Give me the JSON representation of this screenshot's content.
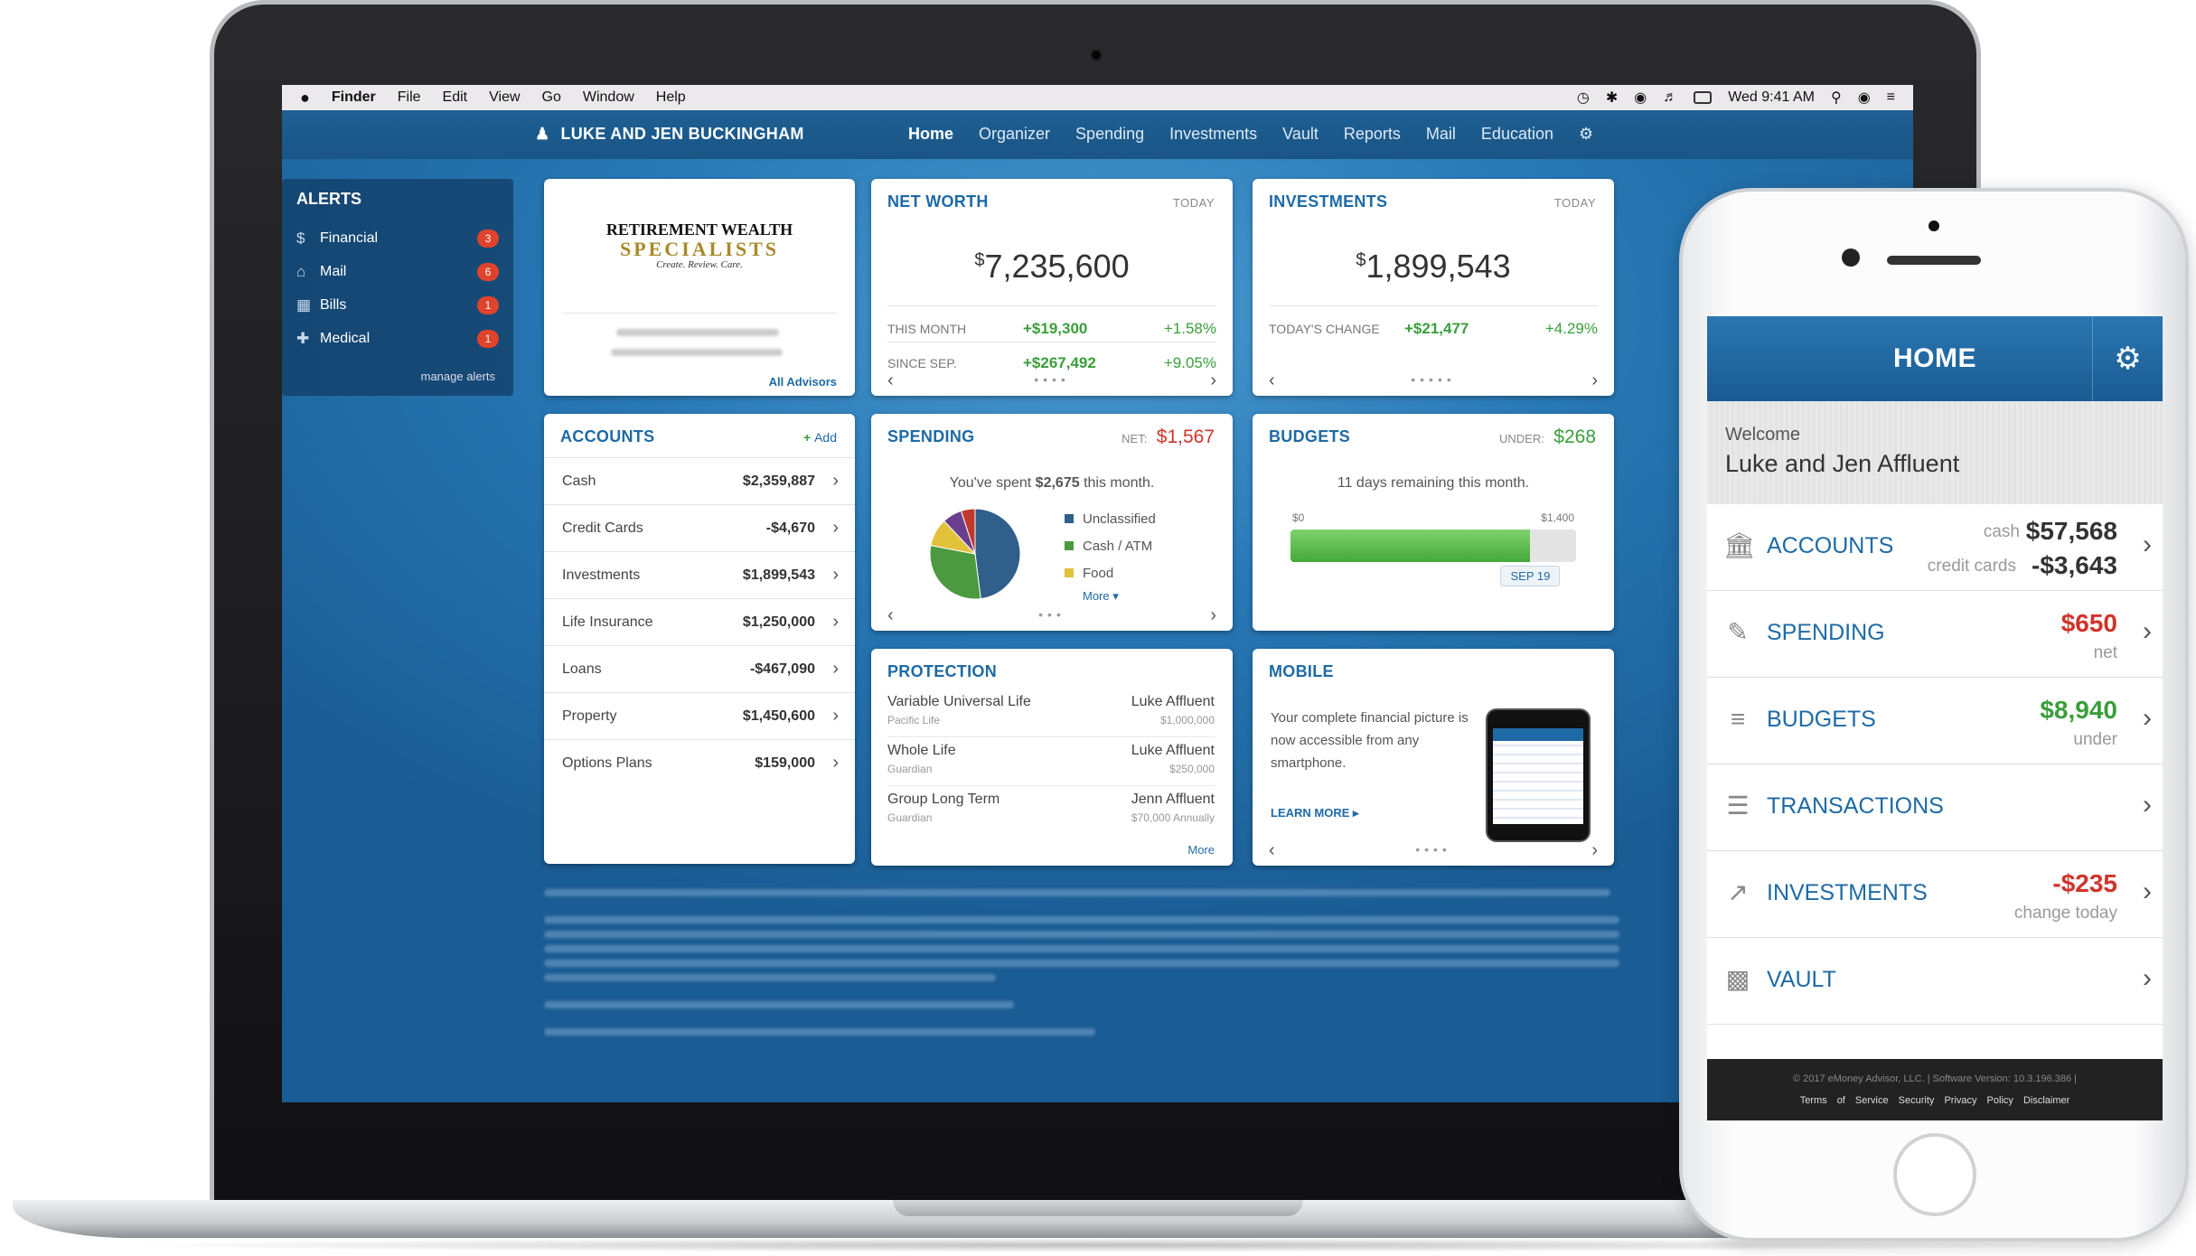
{
  "menubar": {
    "apple": "",
    "items": [
      "Finder",
      "File",
      "Edit",
      "View",
      "Go",
      "Window",
      "Help"
    ],
    "clock": "Wed 9:41 AM"
  },
  "app": {
    "user": "LUKE AND JEN BUCKINGHAM",
    "nav": [
      "Home",
      "Organizer",
      "Spending",
      "Investments",
      "Vault",
      "Reports",
      "Mail",
      "Education"
    ]
  },
  "alerts": {
    "title": "ALERTS",
    "items": [
      {
        "label": "Financial",
        "count": "3"
      },
      {
        "label": "Mail",
        "count": "6"
      },
      {
        "label": "Bills",
        "count": "1"
      },
      {
        "label": "Medical",
        "count": "1"
      }
    ],
    "manage": "manage alerts"
  },
  "advisor": {
    "logo_line1": "RETIREMENT WEALTH",
    "logo_line2": "SPECIALISTS",
    "tagline": "Create. Review. Care.",
    "all_advisors": "All Advisors"
  },
  "net_worth": {
    "title": "NET WORTH",
    "tag": "TODAY",
    "currency": "$",
    "value": "7,235,600",
    "row1": {
      "label": "THIS MONTH",
      "v1": "+$19,300",
      "v2": "+1.58%"
    },
    "row2": {
      "label": "SINCE SEP.",
      "v1": "+$267,492",
      "v2": "+9.05%"
    }
  },
  "investments": {
    "title": "INVESTMENTS",
    "tag": "TODAY",
    "currency": "$",
    "value": "1,899,543",
    "row1": {
      "label": "TODAY'S CHANGE",
      "v1": "+$21,477",
      "v2": "+4.29%"
    }
  },
  "accounts": {
    "title": "ACCOUNTS",
    "add": "Add",
    "rows": [
      {
        "label": "Cash",
        "value": "$2,359,887"
      },
      {
        "label": "Credit Cards",
        "value": "-$4,670"
      },
      {
        "label": "Investments",
        "value": "$1,899,543"
      },
      {
        "label": "Life Insurance",
        "value": "$1,250,000"
      },
      {
        "label": "Loans",
        "value": "-$467,090"
      },
      {
        "label": "Property",
        "value": "$1,450,600"
      },
      {
        "label": "Options Plans",
        "value": "$159,000"
      }
    ]
  },
  "spending": {
    "title": "SPENDING",
    "net_label": "NET:",
    "net_value": "$1,567",
    "summary_pre": "You've spent",
    "summary_amt": "$2,675",
    "summary_post": "this month.",
    "legend": [
      {
        "label": "Unclassified",
        "color": "#2f5f8a"
      },
      {
        "label": "Cash / ATM",
        "color": "#4b9a3f"
      },
      {
        "label": "Food",
        "color": "#e2c23a"
      }
    ],
    "more": "More",
    "slices": [
      {
        "value": 0.48,
        "color": "#2f5f8a"
      },
      {
        "value": 0.3,
        "color": "#4b9a3f"
      },
      {
        "value": 0.1,
        "color": "#e2c23a"
      },
      {
        "value": 0.07,
        "color": "#6a3f8f"
      },
      {
        "value": 0.05,
        "color": "#c0392b"
      }
    ]
  },
  "budgets": {
    "title": "BUDGETS",
    "under_label": "UNDER:",
    "under_value": "$268",
    "remaining": "11 days remaining this month.",
    "min": "$0",
    "max": "$1,400",
    "progress": 0.84,
    "marker": "SEP 19"
  },
  "protection": {
    "title": "PROTECTION",
    "rows": [
      {
        "name": "Variable Universal Life",
        "carrier": "Pacific Life",
        "owner": "Luke Affluent",
        "amount": "$1,000,000"
      },
      {
        "name": "Whole Life",
        "carrier": "Guardian",
        "owner": "Luke Affluent",
        "amount": "$250,000"
      },
      {
        "name": "Group Long Term",
        "carrier": "Guardian",
        "owner": "Jenn Affluent",
        "amount": "$70,000 Annually"
      }
    ],
    "more": "More"
  },
  "mobile": {
    "title": "MOBILE",
    "text": "Your complete financial picture is now accessible from any smartphone.",
    "learn_more": "LEARN MORE"
  },
  "phone": {
    "title": "HOME",
    "welcome": "Welcome",
    "name": "Luke and Jen Affluent",
    "rows": [
      {
        "label": "ACCOUNTS",
        "icon": "bank-icon",
        "sub1": "cash",
        "val1": "$57,568",
        "sub2": "credit cards",
        "val2": "-$3,643"
      },
      {
        "label": "SPENDING",
        "icon": "spending-icon",
        "val1": "$650",
        "sub2": "net"
      },
      {
        "label": "BUDGETS",
        "icon": "budgets-icon",
        "val1": "$8,940",
        "sub2": "under"
      },
      {
        "label": "TRANSACTIONS",
        "icon": "list-icon"
      },
      {
        "label": "INVESTMENTS",
        "icon": "chart-icon",
        "val1": "-$235",
        "sub2": "change today"
      },
      {
        "label": "VAULT",
        "icon": "folder-icon"
      }
    ],
    "footer_line": "© 2017 eMoney Advisor, LLC. | Software Version: 10.3.196.386 |",
    "footer_links": "Terms of Service Security Privacy Policy Disclaimer"
  }
}
